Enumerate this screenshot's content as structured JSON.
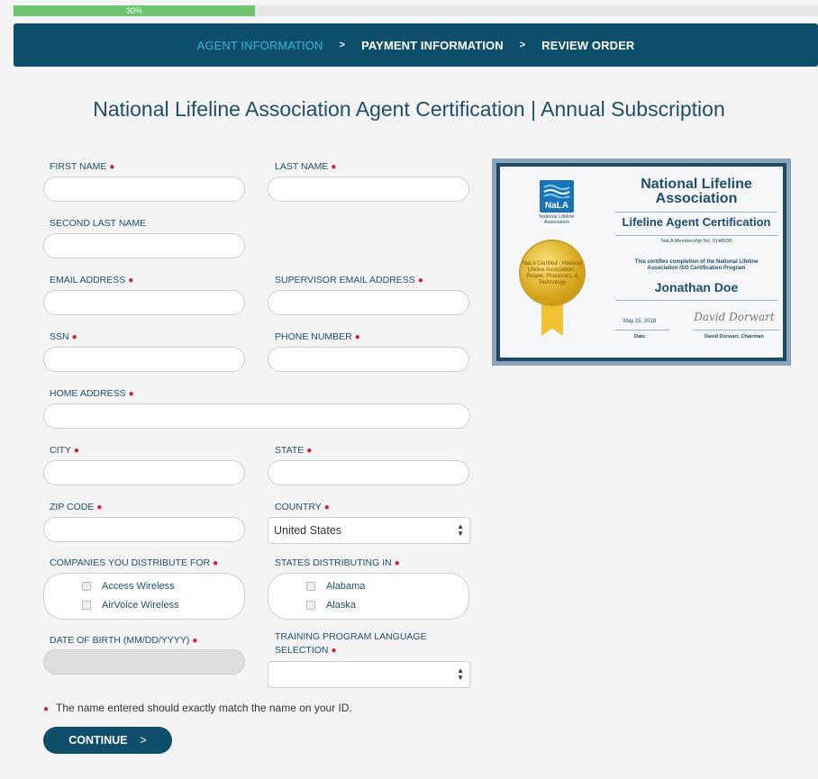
{
  "progress": {
    "label": "30%",
    "value": 0.3,
    "color": "#6cc46f"
  },
  "steps": [
    {
      "label": "AGENT INFORMATION",
      "active": true
    },
    {
      "label": "PAYMENT INFORMATION",
      "active": false
    },
    {
      "label": "REVIEW ORDER",
      "active": false
    }
  ],
  "step_separator": ">",
  "title": "National Lifeline Association Agent Certification | Annual Subscription",
  "required_marker": "●",
  "form": {
    "first_name": {
      "label": "FIRST NAME",
      "value": ""
    },
    "last_name": {
      "label": "LAST NAME",
      "value": ""
    },
    "second_last_name": {
      "label": "SECOND LAST NAME",
      "value": ""
    },
    "email": {
      "label": "EMAIL ADDRESS",
      "value": ""
    },
    "supervisor_email": {
      "label": "SUPERVISOR EMAIL ADDRESS",
      "value": ""
    },
    "ssn": {
      "label": "SSN",
      "value": ""
    },
    "phone": {
      "label": "PHONE NUMBER",
      "value": ""
    },
    "home_address": {
      "label": "HOME ADDRESS",
      "value": ""
    },
    "city": {
      "label": "CITY",
      "value": ""
    },
    "state": {
      "label": "STATE",
      "value": ""
    },
    "zip": {
      "label": "ZIP CODE",
      "value": ""
    },
    "country": {
      "label": "COUNTRY",
      "value": "United States"
    },
    "companies": {
      "label": "COMPANIES YOU DISTRIBUTE FOR",
      "options": [
        "Access Wireless",
        "AirVoice Wireless"
      ]
    },
    "states_distributing": {
      "label": "STATES DISTRIBUTING IN",
      "options": [
        "Alabama",
        "Alaska"
      ]
    },
    "dob": {
      "label": "DATE OF BIRTH (MM/DD/YYYY)",
      "value": ""
    },
    "language": {
      "label_line1": "TRAINING PROGRAM LANGUAGE",
      "label_line2": "SELECTION",
      "value": ""
    }
  },
  "note": "The name entered should exactly match the name on your ID.",
  "continue_label": "CONTINUE",
  "continue_chevron": ">",
  "certificate": {
    "logo_text": "NaLA",
    "logo_sub": "National Lifeline Association",
    "seal_text": "NaLA Certified · National Lifeline Association · People, Processes, & Technology",
    "title_line1": "National Lifeline",
    "title_line2": "Association",
    "subtitle": "Lifeline Agent Certification",
    "membership": "NaLA Membership No.  0148938",
    "cert_line1": "This certifies completion of the National Lifeline",
    "cert_line2": "Association ISO Certification Program",
    "name": "Jonathan Doe",
    "date": "May 15, 2018",
    "signature": "David Dorwart",
    "date_label": "Date",
    "signer": "David Dorwart, Chairman"
  },
  "colors": {
    "brand_dark": "#0d4f6b",
    "active_step": "#39b3d5",
    "label_text": "#1e4e6a",
    "required": "#e0182d"
  }
}
